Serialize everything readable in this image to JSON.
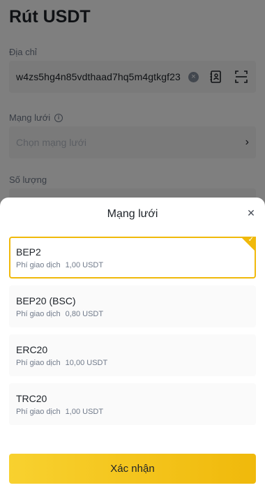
{
  "page": {
    "title": "Rút USDT",
    "address_label": "Địa chỉ",
    "address_value": "w4zs5hg4n85vdthaad7hq5m4gtkgf23",
    "network_label": "Mạng lưới",
    "network_placeholder": "Chọn mạng lưới",
    "amount_label": "Số lượng"
  },
  "sheet": {
    "title": "Mạng lưới",
    "confirm_label": "Xác nhận",
    "networks": [
      {
        "name": "BEP2",
        "fee_label": "Phí giao dịch",
        "fee_value": "1,00 USDT",
        "selected": true
      },
      {
        "name": "BEP20 (BSC)",
        "fee_label": "Phí giao dịch",
        "fee_value": "0,80 USDT",
        "selected": false
      },
      {
        "name": "ERC20",
        "fee_label": "Phí giao dịch",
        "fee_value": "10,00 USDT",
        "selected": false
      },
      {
        "name": "TRC20",
        "fee_label": "Phí giao dịch",
        "fee_value": "1,00 USDT",
        "selected": false
      }
    ]
  },
  "icons": {
    "clear": "clear-icon",
    "address_book": "address-book-icon",
    "scan": "scan-icon",
    "info": "info-icon",
    "chevron": "chevron-right-icon",
    "close": "close-icon",
    "check": "check-icon"
  },
  "colors": {
    "accent": "#f0b90b",
    "text": "#1e2329",
    "muted": "#707a8a"
  }
}
